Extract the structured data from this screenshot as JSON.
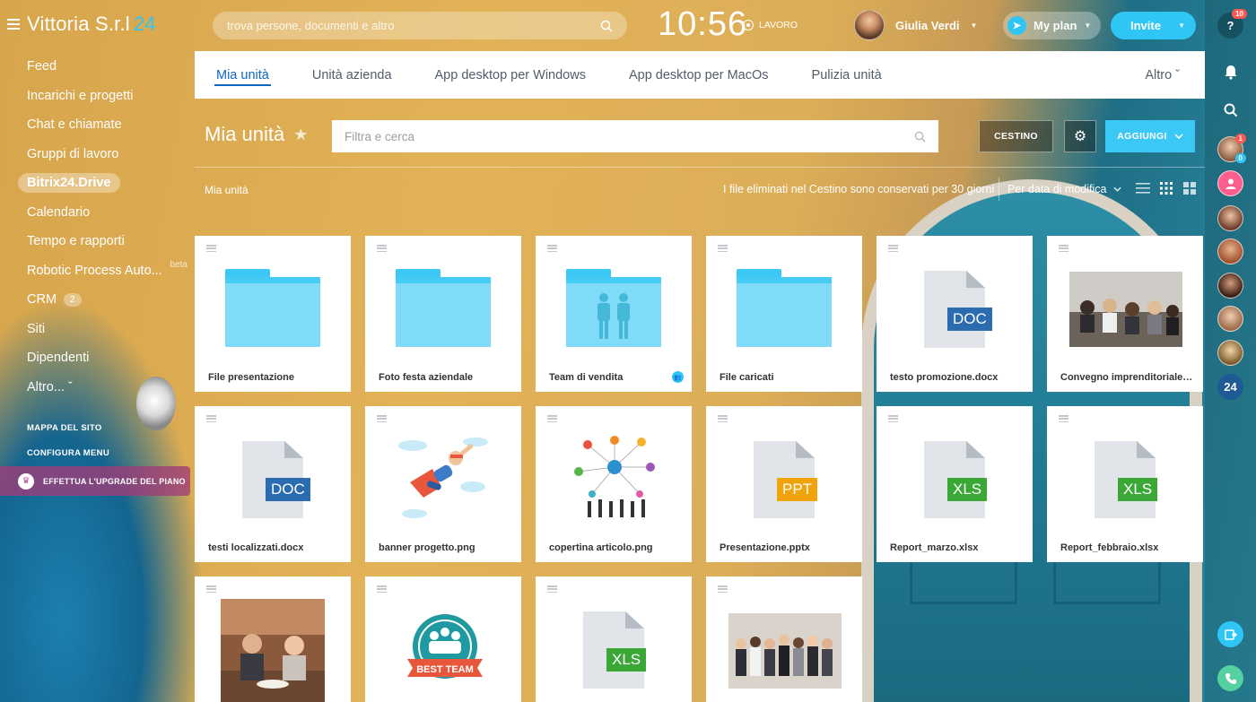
{
  "brand": {
    "name": "Vittoria S.r.l",
    "number": "24"
  },
  "sidebar": {
    "items": [
      {
        "label": "Feed"
      },
      {
        "label": "Incarichi e progetti"
      },
      {
        "label": "Chat e chiamate"
      },
      {
        "label": "Gruppi di lavoro"
      },
      {
        "label": "Bitrix24.Drive",
        "active": true
      },
      {
        "label": "Calendario"
      },
      {
        "label": "Tempo e rapporti"
      },
      {
        "label": "Robotic Process Auto...",
        "tag": "beta"
      },
      {
        "label": "CRM",
        "badge": "2"
      },
      {
        "label": "Siti"
      },
      {
        "label": "Dipendenti"
      },
      {
        "label": "Altro... ˇ"
      }
    ],
    "sitemap": "MAPPA DEL SITO",
    "configure": "CONFIGURA MENU",
    "upgrade": "EFFETTUA L'UPGRADE DEL PIANO"
  },
  "header": {
    "search_placeholder": "trova persone, documenti e altro",
    "clock": "10:56",
    "work_status": "LAVORO",
    "user_name": "Giulia Verdi",
    "plan_label": "My plan",
    "invite_label": "Invite"
  },
  "rail": {
    "help": "?",
    "help_badge": "10",
    "chat_badge": "1",
    "chat_badge2": "0",
    "bitrix_label": "24"
  },
  "tabs": [
    {
      "label": "Mia unità",
      "active": true
    },
    {
      "label": "Unità azienda"
    },
    {
      "label": "App desktop per Windows"
    },
    {
      "label": "App desktop per MacOs"
    },
    {
      "label": "Pulizia unità"
    }
  ],
  "tabs_more": "Altro ˇ",
  "toolbar": {
    "title": "Mia unità",
    "filter_placeholder": "Filtra e cerca",
    "trash_label": "CESTINO",
    "add_label": "AGGIUNGI"
  },
  "breadcrumb": "Mia unità",
  "info_note": "I file eliminati nel Cestino sono conservati per 30 giorni",
  "sort_label": "Per data di modifica",
  "files": [
    {
      "name": "File presentazione",
      "kind": "folder"
    },
    {
      "name": "Foto festa aziendale",
      "kind": "folder"
    },
    {
      "name": "Team di vendita",
      "kind": "shared-folder"
    },
    {
      "name": "File caricati",
      "kind": "folder"
    },
    {
      "name": "testo promozione.docx",
      "kind": "doc",
      "label": "DOC",
      "color": "#2b6cb0"
    },
    {
      "name": "Convegno imprenditoriale.j...",
      "kind": "image"
    },
    {
      "name": "testi localizzati.docx",
      "kind": "doc",
      "label": "DOC",
      "color": "#2b6cb0"
    },
    {
      "name": "banner progetto.png",
      "kind": "image"
    },
    {
      "name": "copertina articolo.png",
      "kind": "image"
    },
    {
      "name": "Presentazione.pptx",
      "kind": "doc",
      "label": "PPT",
      "color": "#f0a30a"
    },
    {
      "name": "Report_marzo.xlsx",
      "kind": "doc",
      "label": "XLS",
      "color": "#3aa736"
    },
    {
      "name": "Report_febbraio.xlsx",
      "kind": "doc",
      "label": "XLS",
      "color": "#3aa736"
    },
    {
      "name": "",
      "kind": "image"
    },
    {
      "name": "",
      "kind": "image",
      "text": "BEST TEAM"
    },
    {
      "name": "",
      "kind": "doc",
      "label": "XLS",
      "color": "#3aa736"
    },
    {
      "name": "",
      "kind": "image"
    }
  ]
}
